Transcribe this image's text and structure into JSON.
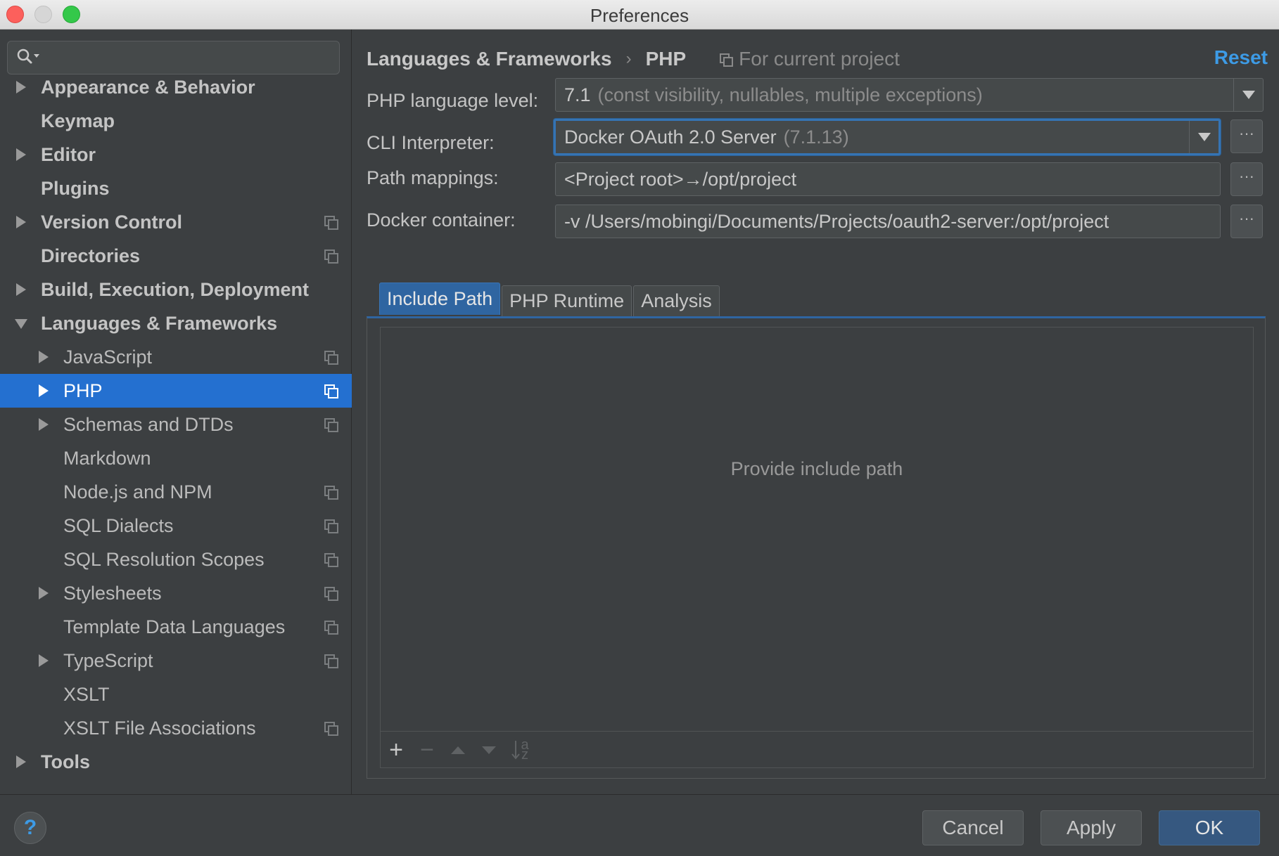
{
  "window": {
    "title": "Preferences"
  },
  "sidebar": {
    "search": {
      "placeholder": ""
    },
    "items": [
      {
        "label": "Appearance & Behavior",
        "bold": true,
        "expander": "collapsed",
        "level": 0,
        "project": false,
        "selected": false
      },
      {
        "label": "Keymap",
        "bold": true,
        "expander": "none",
        "level": 0,
        "project": false,
        "selected": false
      },
      {
        "label": "Editor",
        "bold": true,
        "expander": "collapsed",
        "level": 0,
        "project": false,
        "selected": false
      },
      {
        "label": "Plugins",
        "bold": true,
        "expander": "none",
        "level": 0,
        "project": false,
        "selected": false
      },
      {
        "label": "Version Control",
        "bold": true,
        "expander": "collapsed",
        "level": 0,
        "project": true,
        "selected": false
      },
      {
        "label": "Directories",
        "bold": true,
        "expander": "none",
        "level": 0,
        "project": true,
        "selected": false
      },
      {
        "label": "Build, Execution, Deployment",
        "bold": true,
        "expander": "collapsed",
        "level": 0,
        "project": false,
        "selected": false
      },
      {
        "label": "Languages & Frameworks",
        "bold": true,
        "expander": "expanded",
        "level": 0,
        "project": false,
        "selected": false
      },
      {
        "label": "JavaScript",
        "bold": false,
        "expander": "collapsed",
        "level": 1,
        "project": true,
        "selected": false
      },
      {
        "label": "PHP",
        "bold": false,
        "expander": "collapsed",
        "level": 1,
        "project": true,
        "selected": true
      },
      {
        "label": "Schemas and DTDs",
        "bold": false,
        "expander": "collapsed",
        "level": 1,
        "project": true,
        "selected": false
      },
      {
        "label": "Markdown",
        "bold": false,
        "expander": "none",
        "level": 1,
        "project": false,
        "selected": false
      },
      {
        "label": "Node.js and NPM",
        "bold": false,
        "expander": "none",
        "level": 1,
        "project": true,
        "selected": false
      },
      {
        "label": "SQL Dialects",
        "bold": false,
        "expander": "none",
        "level": 1,
        "project": true,
        "selected": false
      },
      {
        "label": "SQL Resolution Scopes",
        "bold": false,
        "expander": "none",
        "level": 1,
        "project": true,
        "selected": false
      },
      {
        "label": "Stylesheets",
        "bold": false,
        "expander": "collapsed",
        "level": 1,
        "project": true,
        "selected": false
      },
      {
        "label": "Template Data Languages",
        "bold": false,
        "expander": "none",
        "level": 1,
        "project": true,
        "selected": false
      },
      {
        "label": "TypeScript",
        "bold": false,
        "expander": "collapsed",
        "level": 1,
        "project": true,
        "selected": false
      },
      {
        "label": "XSLT",
        "bold": false,
        "expander": "none",
        "level": 1,
        "project": false,
        "selected": false
      },
      {
        "label": "XSLT File Associations",
        "bold": false,
        "expander": "none",
        "level": 1,
        "project": true,
        "selected": false
      },
      {
        "label": "Tools",
        "bold": true,
        "expander": "collapsed",
        "level": 0,
        "project": false,
        "selected": false
      }
    ]
  },
  "breadcrumb": {
    "parent": "Languages & Frameworks",
    "separator": "›",
    "current": "PHP",
    "scope": "For current project"
  },
  "reset_label": "Reset",
  "form": {
    "language_level": {
      "label": "PHP language level:",
      "value": "7.1",
      "hint": "(const visibility, nullables, multiple exceptions)"
    },
    "cli_interpreter": {
      "label": "CLI Interpreter:",
      "value": "Docker OAuth 2.0 Server",
      "hint": "(7.1.13)"
    },
    "path_mappings": {
      "label": "Path mappings:",
      "value": "<Project root>→/opt/project"
    },
    "docker_container": {
      "label": "Docker container:",
      "value": "-v /Users/mobingi/Documents/Projects/oauth2-server:/opt/project"
    },
    "browse_label": "···"
  },
  "tabs": [
    {
      "label": "Include Path",
      "active": true
    },
    {
      "label": "PHP Runtime",
      "active": false
    },
    {
      "label": "Analysis",
      "active": false
    }
  ],
  "include_path": {
    "empty_text": "Provide include path",
    "toolbar": {
      "add": "+",
      "remove": "−",
      "sort_top": "a",
      "sort_bottom": "z"
    }
  },
  "footer": {
    "help": "?",
    "cancel": "Cancel",
    "apply": "Apply",
    "ok": "OK"
  },
  "colors": {
    "background": "#3c3f41",
    "selection": "#2470d0",
    "link": "#3d9be6",
    "active_tab": "#2f65a1",
    "focus_border": "#3574b4"
  }
}
